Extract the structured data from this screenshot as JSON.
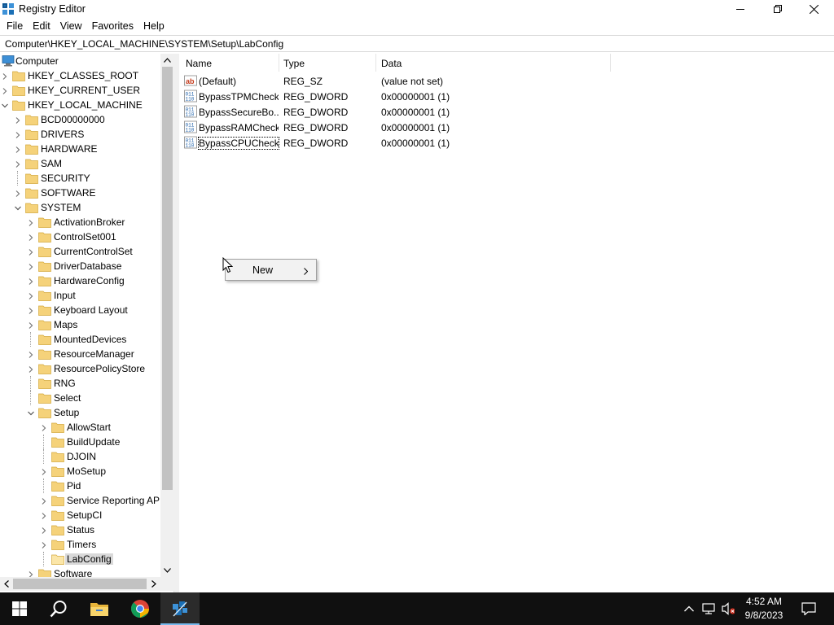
{
  "window": {
    "title": "Registry Editor"
  },
  "menu": [
    "File",
    "Edit",
    "View",
    "Favorites",
    "Help"
  ],
  "address": "Computer\\HKEY_LOCAL_MACHINE\\SYSTEM\\Setup\\LabConfig",
  "tree": [
    {
      "label": "Computer",
      "level": 0,
      "icon": "computer-icon",
      "expander": "none"
    },
    {
      "label": "HKEY_CLASSES_ROOT",
      "level": 1,
      "expander": "collapsed"
    },
    {
      "label": "HKEY_CURRENT_USER",
      "level": 1,
      "expander": "collapsed"
    },
    {
      "label": "HKEY_LOCAL_MACHINE",
      "level": 1,
      "expander": "expanded"
    },
    {
      "label": "BCD00000000",
      "level": 2,
      "expander": "collapsed"
    },
    {
      "label": "DRIVERS",
      "level": 2,
      "expander": "collapsed"
    },
    {
      "label": "HARDWARE",
      "level": 2,
      "expander": "collapsed"
    },
    {
      "label": "SAM",
      "level": 2,
      "expander": "collapsed"
    },
    {
      "label": "SECURITY",
      "level": 2,
      "expander": "none"
    },
    {
      "label": "SOFTWARE",
      "level": 2,
      "expander": "collapsed"
    },
    {
      "label": "SYSTEM",
      "level": 2,
      "expander": "expanded"
    },
    {
      "label": "ActivationBroker",
      "level": 3,
      "expander": "collapsed"
    },
    {
      "label": "ControlSet001",
      "level": 3,
      "expander": "collapsed"
    },
    {
      "label": "CurrentControlSet",
      "level": 3,
      "expander": "collapsed"
    },
    {
      "label": "DriverDatabase",
      "level": 3,
      "expander": "collapsed"
    },
    {
      "label": "HardwareConfig",
      "level": 3,
      "expander": "collapsed"
    },
    {
      "label": "Input",
      "level": 3,
      "expander": "collapsed"
    },
    {
      "label": "Keyboard Layout",
      "level": 3,
      "expander": "collapsed"
    },
    {
      "label": "Maps",
      "level": 3,
      "expander": "collapsed"
    },
    {
      "label": "MountedDevices",
      "level": 3,
      "expander": "none"
    },
    {
      "label": "ResourceManager",
      "level": 3,
      "expander": "collapsed"
    },
    {
      "label": "ResourcePolicyStore",
      "level": 3,
      "expander": "collapsed"
    },
    {
      "label": "RNG",
      "level": 3,
      "expander": "none"
    },
    {
      "label": "Select",
      "level": 3,
      "expander": "none"
    },
    {
      "label": "Setup",
      "level": 3,
      "expander": "expanded"
    },
    {
      "label": "AllowStart",
      "level": 4,
      "expander": "collapsed"
    },
    {
      "label": "BuildUpdate",
      "level": 4,
      "expander": "none"
    },
    {
      "label": "DJOIN",
      "level": 4,
      "expander": "none"
    },
    {
      "label": "MoSetup",
      "level": 4,
      "expander": "collapsed"
    },
    {
      "label": "Pid",
      "level": 4,
      "expander": "none"
    },
    {
      "label": "Service Reporting API",
      "level": 4,
      "expander": "collapsed"
    },
    {
      "label": "SetupCI",
      "level": 4,
      "expander": "collapsed"
    },
    {
      "label": "Status",
      "level": 4,
      "expander": "collapsed"
    },
    {
      "label": "Timers",
      "level": 4,
      "expander": "collapsed"
    },
    {
      "label": "LabConfig",
      "level": 4,
      "expander": "none",
      "selected": true
    },
    {
      "label": "Software",
      "level": 3,
      "expander": "collapsed"
    }
  ],
  "columns": {
    "name": "Name",
    "type": "Type",
    "data": "Data"
  },
  "values": [
    {
      "name": "(Default)",
      "type": "REG_SZ",
      "data": "(value not set)",
      "icon": "string-value-icon"
    },
    {
      "name": "BypassTPMCheck",
      "type": "REG_DWORD",
      "data": "0x00000001 (1)",
      "icon": "binary-value-icon"
    },
    {
      "name": "BypassSecureBo...",
      "type": "REG_DWORD",
      "data": "0x00000001 (1)",
      "icon": "binary-value-icon"
    },
    {
      "name": "BypassRAMCheck",
      "type": "REG_DWORD",
      "data": "0x00000001 (1)",
      "icon": "binary-value-icon"
    },
    {
      "name": "BypassCPUCheck",
      "type": "REG_DWORD",
      "data": "0x00000001 (1)",
      "icon": "binary-value-icon",
      "focused": true
    }
  ],
  "context_menu": {
    "items": [
      {
        "label": "New",
        "has_submenu": true
      }
    ]
  },
  "taskbar": {
    "apps": [
      "windows-start-icon",
      "search-icon",
      "file-explorer-icon",
      "chrome-icon",
      "regedit-icon"
    ],
    "time": "4:52 AM",
    "date": "9/8/2023"
  },
  "colors": {
    "accent": "#76b9ed",
    "selection": "#d9d9d9",
    "taskbar": "#101010",
    "folder": "#f5d27a"
  }
}
